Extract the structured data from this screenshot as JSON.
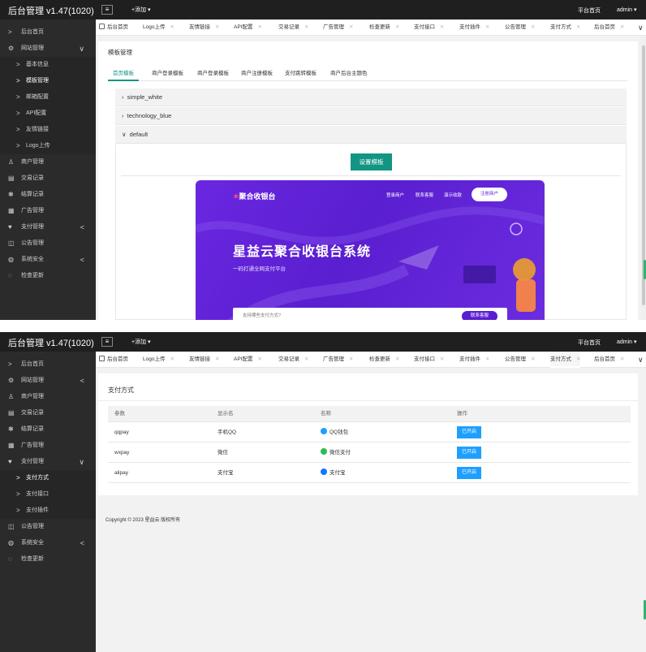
{
  "app": {
    "title": "后台管理 v1.47(1020)",
    "add_label": "+添加 ▾",
    "platform_home": "平台首页",
    "user": "admin ▾"
  },
  "tabs": [
    "后台首页",
    "Logo上传",
    "友情链接",
    "API配置",
    "交易记录",
    "广告管理",
    "检查更新",
    "支付接口",
    "支付插件",
    "公告管理",
    "支付方式",
    "后台首页"
  ],
  "tab_close": "✕",
  "sidebar1": [
    {
      "label": "后台首页",
      "icon": ">"
    },
    {
      "label": "网站管理",
      "icon": "⚙",
      "arrow": "∨"
    },
    {
      "label": "基本信息",
      "icon": ">",
      "sub": true
    },
    {
      "label": "模板管理",
      "icon": ">",
      "sub": true,
      "active": true
    },
    {
      "label": "邮箱配置",
      "icon": ">",
      "sub": true
    },
    {
      "label": "API配置",
      "icon": ">",
      "sub": true
    },
    {
      "label": "友情链接",
      "icon": ">",
      "sub": true
    },
    {
      "label": "Logo上传",
      "icon": ">",
      "sub": true
    },
    {
      "label": "商户管理",
      "icon": "♙"
    },
    {
      "label": "交易记录",
      "icon": "▤"
    },
    {
      "label": "结算记录",
      "icon": "❃"
    },
    {
      "label": "广告管理",
      "icon": "▦"
    },
    {
      "label": "支付管理",
      "icon": "♥",
      "arrow": "<"
    },
    {
      "label": "公告管理",
      "icon": "◫"
    },
    {
      "label": "系统安全",
      "icon": "◍",
      "arrow": "<"
    },
    {
      "label": "检查更新",
      "icon": "◌"
    }
  ],
  "sidebar2": [
    {
      "label": "后台首页",
      "icon": ">"
    },
    {
      "label": "网站管理",
      "icon": "⚙",
      "arrow": "<"
    },
    {
      "label": "商户管理",
      "icon": "♙"
    },
    {
      "label": "交易记录",
      "icon": "▤"
    },
    {
      "label": "结算记录",
      "icon": "❃"
    },
    {
      "label": "广告管理",
      "icon": "▦"
    },
    {
      "label": "支付管理",
      "icon": "♥",
      "arrow": "∨"
    },
    {
      "label": "支付方式",
      "icon": ">",
      "sub": true,
      "active": true
    },
    {
      "label": "支付接口",
      "icon": ">",
      "sub": true
    },
    {
      "label": "支付插件",
      "icon": ">",
      "sub": true
    },
    {
      "label": "公告管理",
      "icon": "◫"
    },
    {
      "label": "系统安全",
      "icon": "◍",
      "arrow": "<"
    },
    {
      "label": "检查更新",
      "icon": "◌"
    }
  ],
  "template_page": {
    "title": "模板管理",
    "subtabs": [
      "首页模板",
      "商户登录模板",
      "商户登录模板",
      "商户注册模板",
      "支付跳转模板",
      "商户后台主题色"
    ],
    "templates": [
      "simple_white",
      "technology_blue",
      "default"
    ],
    "set_button": "设置模板",
    "preview": {
      "logo": "聚合收银台",
      "nav": [
        "登录商户",
        "联系客服",
        "演示收款"
      ],
      "register": "注册商户",
      "headline": "星益云聚合收银台系统",
      "subline": "一码打通全网支付平台",
      "search_placeholder": "支持哪些支付方式?",
      "search_button": "联系客服"
    }
  },
  "pay_page": {
    "title": "支付方式",
    "columns": [
      "参数",
      "显示名",
      "名称",
      "操作"
    ],
    "rows": [
      {
        "param": "qqpay",
        "display": "手机QQ",
        "name": "QQ钱包",
        "op": "已开启",
        "color": "#1e9fff"
      },
      {
        "param": "wxpay",
        "display": "微信",
        "name": "微信支付",
        "op": "已开启",
        "color": "#2dbb55"
      },
      {
        "param": "alipay",
        "display": "支付宝",
        "name": "支付宝",
        "op": "已开启",
        "color": "#1677ff"
      }
    ],
    "copyright": "Copyright © 2023 星益云 版权所有"
  },
  "colors": {
    "accent": "#129583",
    "sidebar": "#2b2b2b",
    "topbar": "#1f1f1f",
    "button_blue": "#1e9fff"
  }
}
